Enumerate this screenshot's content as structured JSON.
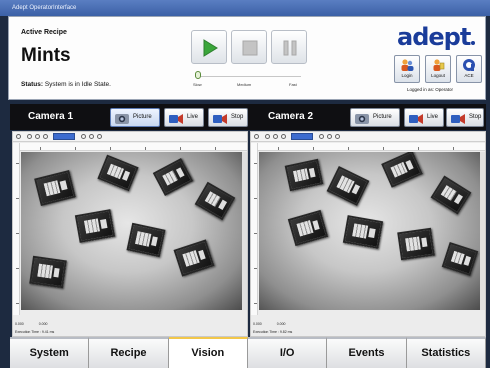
{
  "window": {
    "title": "Adept OperatorInterface"
  },
  "header": {
    "active_recipe_label": "Active Recipe",
    "recipe_name": "Mints",
    "status_label": "Status:",
    "status_text": "System is in Idle State.",
    "speed": {
      "slow": "Slow",
      "medium": "Medium",
      "fast": "Fast",
      "level": 0.02
    },
    "logo": "adept",
    "login_label": "Login",
    "logout_label": "Logout",
    "ace_label": "ACE",
    "logged_in_as": "Logged in as: Operator"
  },
  "cameras": [
    {
      "title": "Camera 1",
      "picture_label": "Picture",
      "live_label": "Live",
      "stop_label": "Stop",
      "readout_x": "0.000",
      "readout_y": "0.000",
      "exec_time": "Execution Time : 9.41 ms"
    },
    {
      "title": "Camera 2",
      "picture_label": "Picture",
      "live_label": "Live",
      "stop_label": "Stop",
      "readout_x": "0.000",
      "readout_y": "0.000",
      "exec_time": "Execution Time : 9.82 ms"
    }
  ],
  "nav": {
    "tabs": [
      "System",
      "Recipe",
      "Vision",
      "I/O",
      "Events",
      "Statistics"
    ],
    "active": "Vision"
  },
  "colors": {
    "accent_active_tab": "#f2c74a",
    "logo_blue": "#1a3c9a",
    "play_green": "#3aa63a",
    "zoom_highlight": "#3d6ccf"
  }
}
